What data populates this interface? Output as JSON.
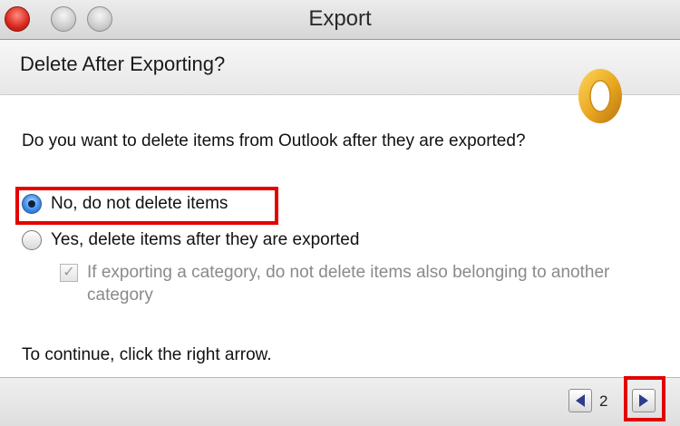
{
  "window": {
    "title": "Export"
  },
  "header": {
    "title": "Delete After Exporting?"
  },
  "question": "Do you want to delete items from Outlook after they are exported?",
  "options": [
    {
      "label": "No, do not delete items",
      "selected": true
    },
    {
      "label": "Yes, delete items after they are exported",
      "selected": false
    }
  ],
  "sub_option": {
    "label": "If exporting a category, do not delete items also belonging to another category",
    "checked": true,
    "disabled": true
  },
  "instruction": "To continue, click the right arrow.",
  "pager": {
    "page": "2"
  },
  "colors": {
    "highlight": "#e50000",
    "logo": "#e8a520",
    "arrow": "#2f3c8a"
  },
  "icons": {
    "logo": "outlook-logo-icon",
    "prev": "arrow-left-icon",
    "next": "arrow-right-icon"
  }
}
